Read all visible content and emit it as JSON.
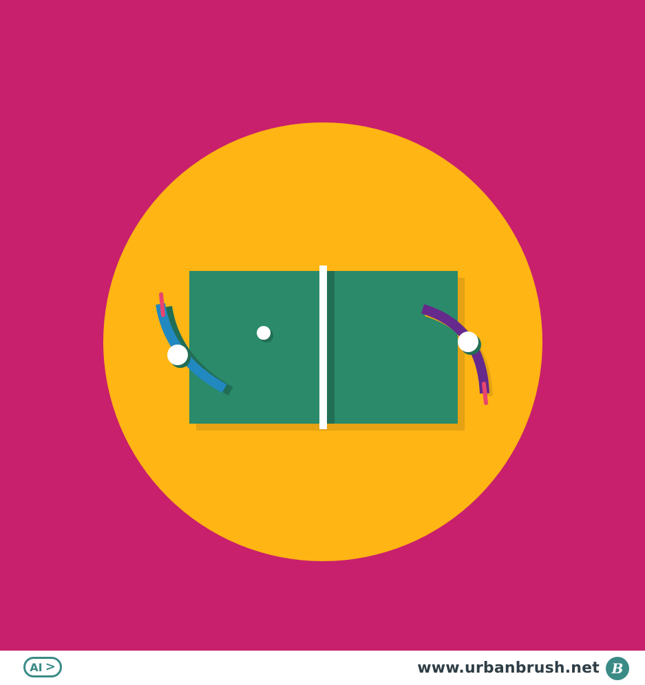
{
  "footer": {
    "badge_label": "AI",
    "badge_arrow": ">",
    "site_url": "www.urbanbrush.net",
    "logo_text": "B"
  },
  "colors": {
    "background": "#c8206c",
    "circle": "#ffb514",
    "circle_shadow": "#e4a214",
    "table": "#2a8a6a",
    "net": "#ffffff",
    "net_shadow": "#226e55",
    "paddle_left": "#2288c0",
    "paddle_right": "#66298c",
    "handle": "#e8456e",
    "ball": "#ffffff",
    "footer_text": "#2f3e46",
    "footer_accent": "#3a8a86"
  },
  "icons": [
    "ai-file-icon",
    "urbanbrush-logo-icon"
  ]
}
